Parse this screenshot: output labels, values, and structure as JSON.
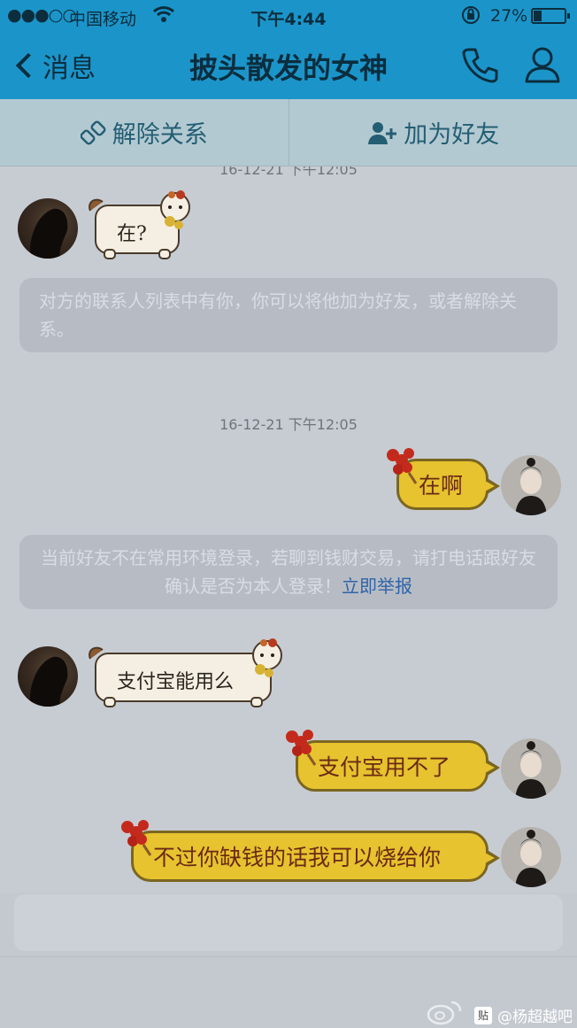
{
  "status_bar": {
    "signal": "●●●○○",
    "carrier": "中国移动",
    "time": "下午4:44",
    "battery_percent": "27%",
    "battery_level": 0.27
  },
  "nav": {
    "back_label": "消息",
    "title": "披头散发的女神"
  },
  "actions": {
    "remove_label": "解除关系",
    "add_friend_label": "加为好友"
  },
  "messages": {
    "timestamp_top": "16-12-21 下午12:05",
    "sticker1_text": "在?",
    "system1_text": "对方的联系人列表中有你，你可以将他加为好友，或者解除关系。",
    "timestamp2": "16-12-21 下午12:05",
    "bubble1_text": "在啊",
    "system2_text": "当前好友不在常用环境登录，若聊到钱财交易，请打电话跟好友确认是否为本人登录！",
    "system2_link": "立即举报",
    "sticker2_text": "支付宝能用么",
    "bubble2_text": "支付宝用不了",
    "bubble3_text": "不过你缺钱的话我可以烧给你"
  },
  "watermark": {
    "tieba_glyph": "贴",
    "text": "@杨超越吧"
  },
  "colors": {
    "nav_bg": "#1b95c9",
    "bubble_bg": "#e6c32f",
    "link": "#2f64a8"
  }
}
